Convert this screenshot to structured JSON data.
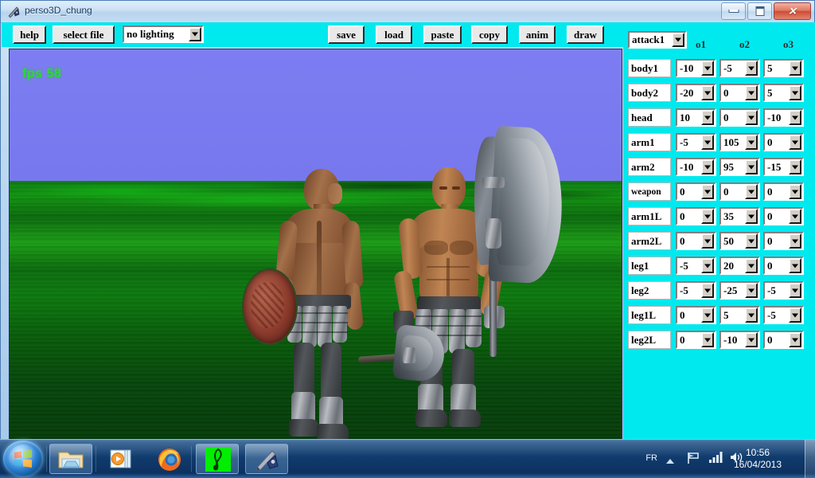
{
  "window": {
    "title": "perso3D_chung",
    "icon": "sword-shield-icon",
    "minimize_label": "",
    "maximize_label": "",
    "close_label": "✕"
  },
  "toolbar": {
    "help_label": "help",
    "select_file_label": "select file",
    "lighting_value": "no lighting",
    "save_label": "save",
    "load_label": "load",
    "paste_label": "paste",
    "copy_label": "copy",
    "anim_label": "anim",
    "draw_label": "draw"
  },
  "viewport": {
    "fps_text": "fps 58",
    "sky_color": "#7b7bf0",
    "ground_color": "#0a6b0c"
  },
  "panel": {
    "animation_value": "attack1",
    "columns": [
      "o1",
      "o2",
      "o3"
    ],
    "rows": [
      {
        "label": "body1",
        "o1": "-10",
        "o2": "-5",
        "o3": "5"
      },
      {
        "label": "body2",
        "o1": "-20",
        "o2": "0",
        "o3": "5"
      },
      {
        "label": "head",
        "o1": "10",
        "o2": "0",
        "o3": "-10"
      },
      {
        "label": "arm1",
        "o1": "-5",
        "o2": "105",
        "o3": "0"
      },
      {
        "label": "arm2",
        "o1": "-10",
        "o2": "95",
        "o3": "-15"
      },
      {
        "label": "weapon",
        "o1": "0",
        "o2": "0",
        "o3": "0"
      },
      {
        "label": "arm1L",
        "o1": "0",
        "o2": "35",
        "o3": "0"
      },
      {
        "label": "arm2L",
        "o1": "0",
        "o2": "50",
        "o3": "0"
      },
      {
        "label": "leg1",
        "o1": "-5",
        "o2": "20",
        "o3": "0"
      },
      {
        "label": "leg2",
        "o1": "-5",
        "o2": "-25",
        "o3": "-5"
      },
      {
        "label": "leg1L",
        "o1": "0",
        "o2": "5",
        "o3": "-5"
      },
      {
        "label": "leg2L",
        "o1": "0",
        "o2": "-10",
        "o3": "0"
      }
    ]
  },
  "taskbar": {
    "start_label": "",
    "items": [
      {
        "icon": "folder-explorer-icon"
      },
      {
        "icon": "media-player-icon"
      },
      {
        "icon": "firefox-icon"
      },
      {
        "icon": "music-note-icon"
      },
      {
        "icon": "sword-shield-icon"
      }
    ],
    "tray": {
      "language": "FR",
      "show_hidden_icon": "chevron-up-icon",
      "network_icon": "flag-icon",
      "signal_icon": "signal-bars-icon",
      "volume_icon": "speaker-icon",
      "time": "10:56",
      "date": "16/04/2013"
    }
  }
}
